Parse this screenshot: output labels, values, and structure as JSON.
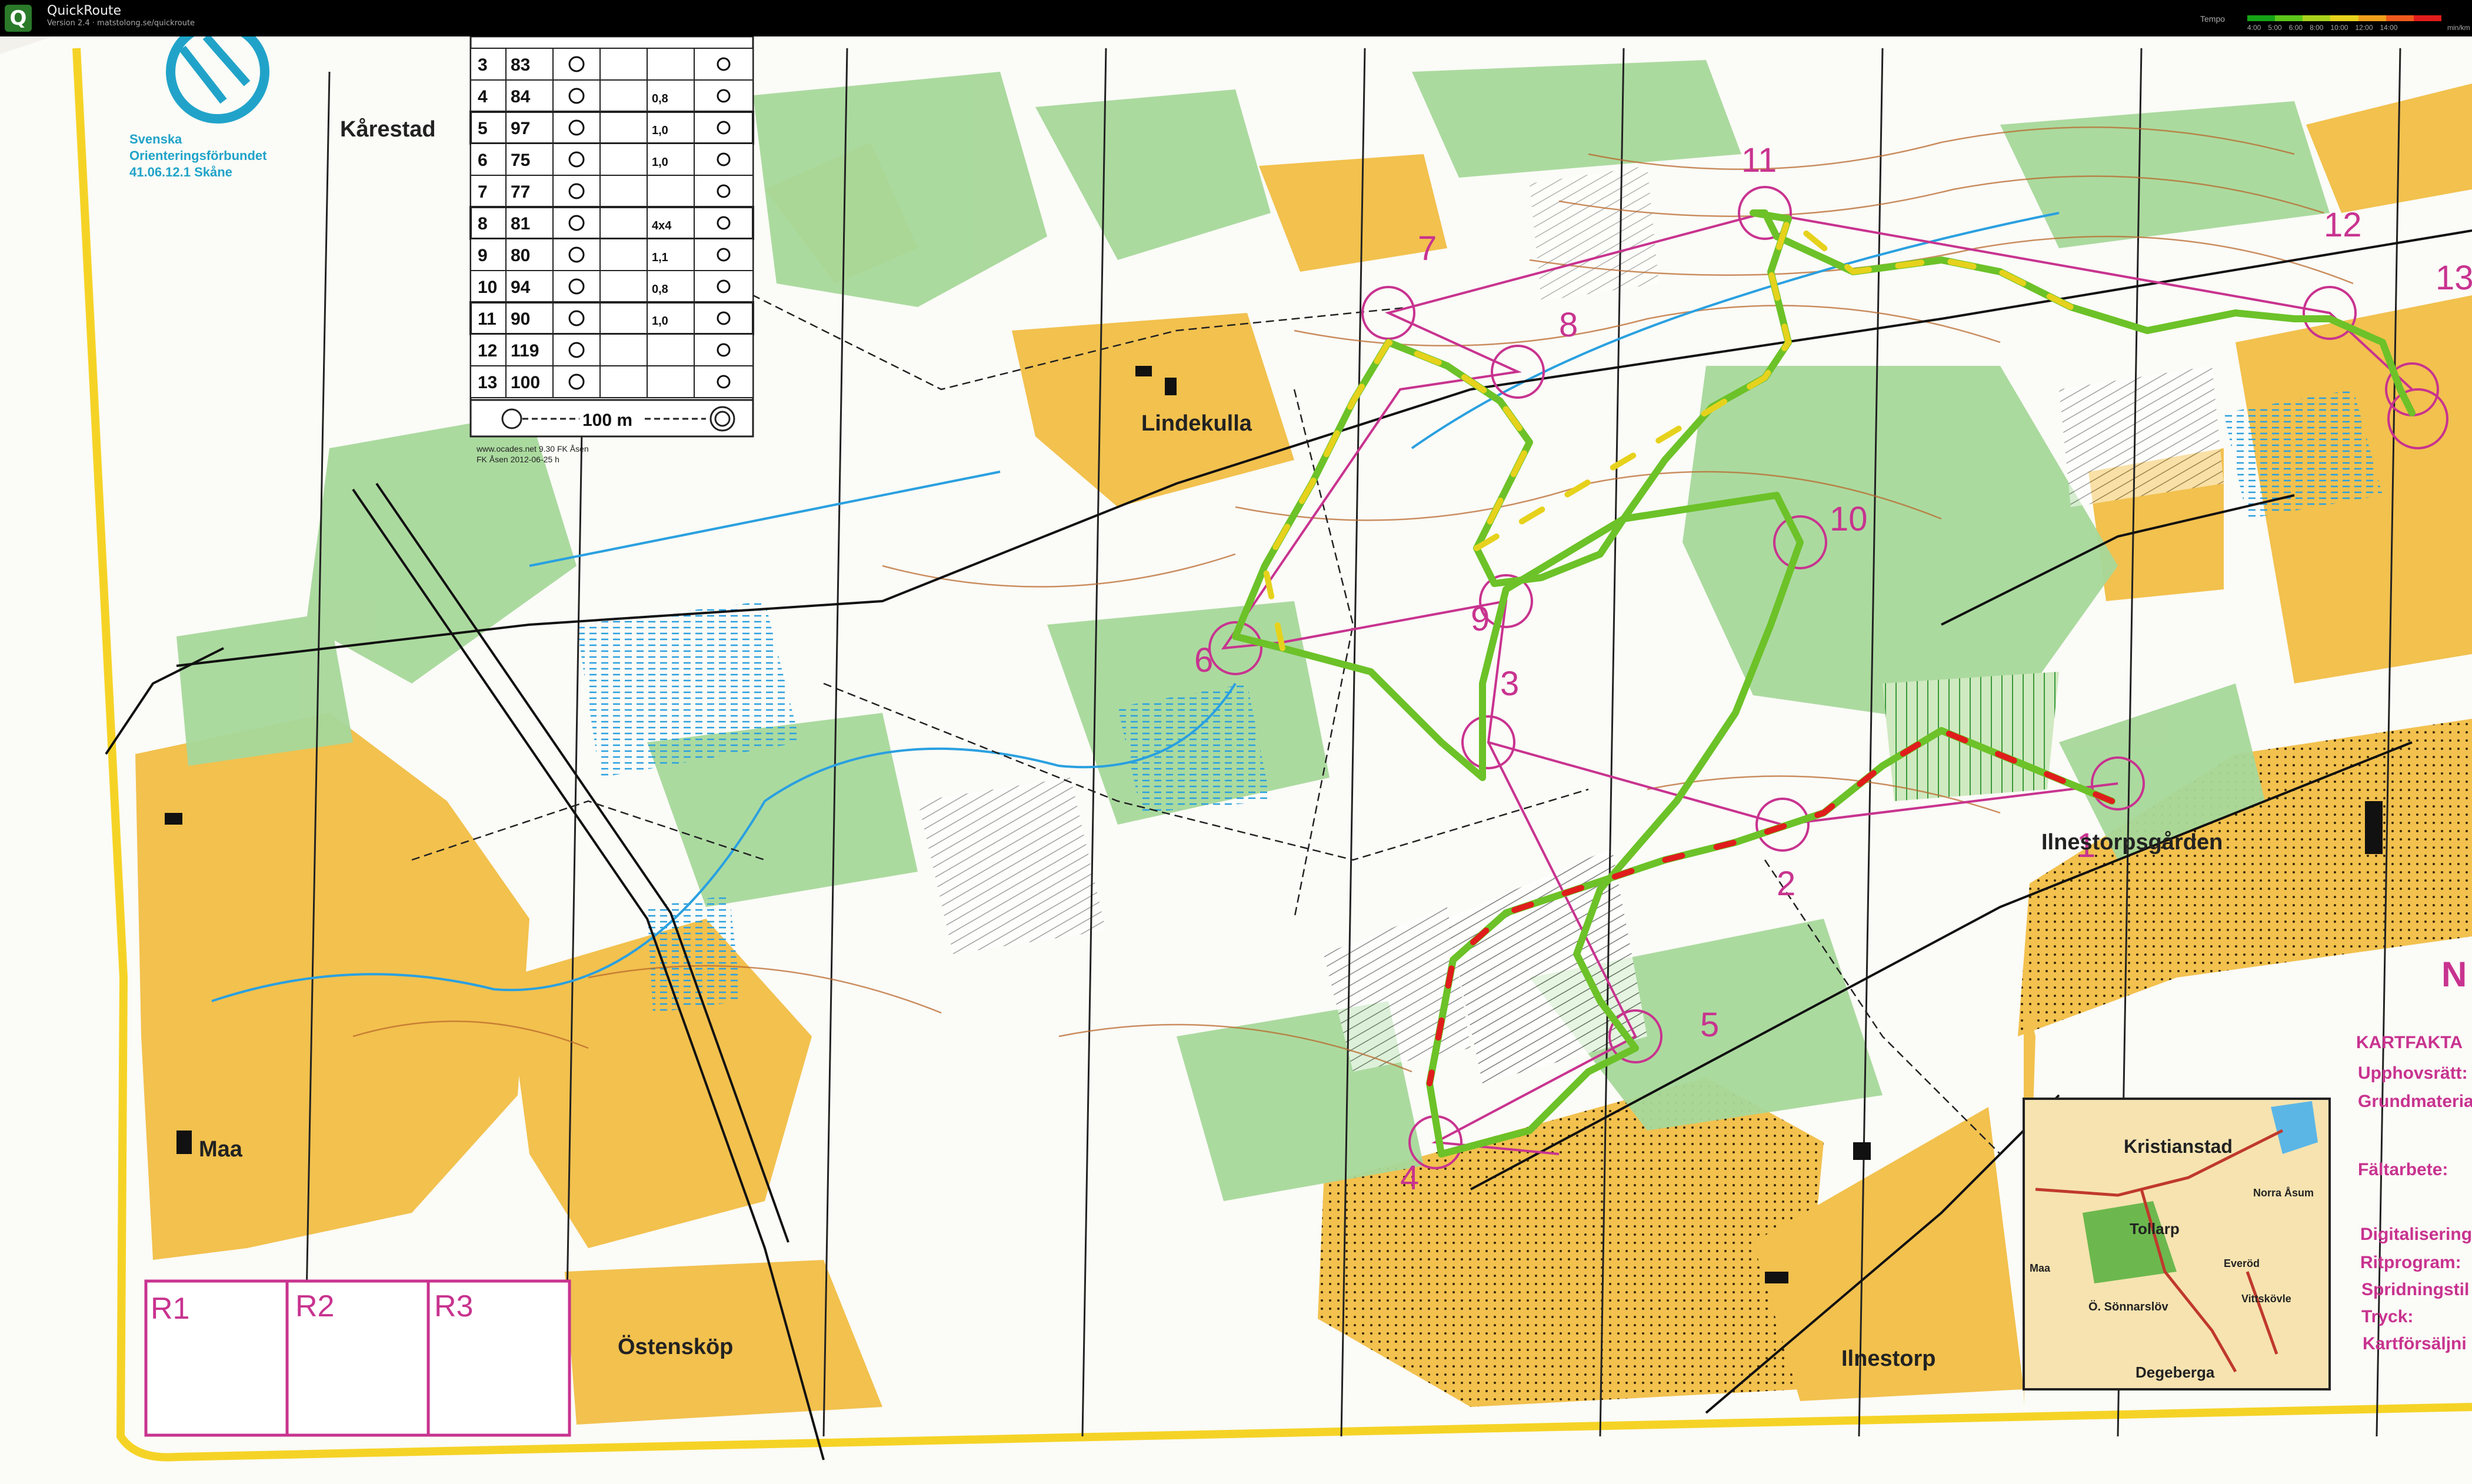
{
  "window": {
    "app_name": "QuickRoute",
    "subtitle_line1": "Version 2.4",
    "subtitle_line2": "matstolong.se/quickroute"
  },
  "speed_legend": {
    "label": "Tempo",
    "ticks": [
      "4:00",
      "5:00",
      "6:00",
      "8:00",
      "10:00",
      "12:00",
      "14:00"
    ],
    "unit": "min/km",
    "colors": [
      "#16a316",
      "#5cc61a",
      "#a8d21c",
      "#e6d21c",
      "#f0a01c",
      "#f05a1c",
      "#e01c1c"
    ]
  },
  "map": {
    "federation": {
      "line1": "Svenska",
      "line2": "Orienteringsförbundet",
      "line3": "41.06.12.1 Skåne"
    },
    "place_names": {
      "karestad": "Kårestad",
      "lindekulla": "Lindekulla",
      "ilnestorpsgarden": "Ilnestorpsgården",
      "maa": "Maa",
      "ostenskop": "Östensköp",
      "ilnestorp": "Ilnestorp"
    },
    "control_description": {
      "rows": [
        {
          "seq": "3",
          "code": "83",
          "val": ""
        },
        {
          "seq": "4",
          "code": "84",
          "val": "0,8"
        },
        {
          "seq": "5",
          "code": "97",
          "val": "1,0"
        },
        {
          "seq": "6",
          "code": "75",
          "val": "1,0"
        },
        {
          "seq": "7",
          "code": "77",
          "val": ""
        },
        {
          "seq": "8",
          "code": "81",
          "val": "4x4"
        },
        {
          "seq": "9",
          "code": "80",
          "val": "1,1"
        },
        {
          "seq": "10",
          "code": "94",
          "val": "0,8"
        },
        {
          "seq": "11",
          "code": "90",
          "val": "1,0"
        },
        {
          "seq": "12",
          "code": "119",
          "val": ""
        },
        {
          "seq": "13",
          "code": "100",
          "val": ""
        }
      ],
      "finish_distance": "100 m",
      "credit1": "www.ocades.net 9.30 FK Åsen",
      "credit2": "FK Åsen 2012-06-25 h"
    },
    "controls": [
      "1",
      "2",
      "3",
      "4",
      "5",
      "6",
      "7",
      "8",
      "9",
      "10",
      "11",
      "12",
      "13"
    ],
    "kartfakta": {
      "heading": "N",
      "title": "KARTFAKTA",
      "lines": [
        "Upphovsrätt:",
        "Grundmateria",
        "Fältarbete:",
        "Digitalisering",
        "Ritprogram:",
        "Spridningstil",
        "Tryck:",
        "Kartförsäljni"
      ]
    },
    "inset": {
      "kristianstad": "Kristianstad",
      "norra_asum": "Norra Åsum",
      "tollarp": "Tollarp",
      "maa": "Maa",
      "sonnarslov": "Ö. Sönnarslöv",
      "everod": "Everöd",
      "vittskovle": "Vittskövle",
      "degeberga": "Degeberga"
    },
    "result_boxes": [
      "R1",
      "R2",
      "R3"
    ]
  }
}
